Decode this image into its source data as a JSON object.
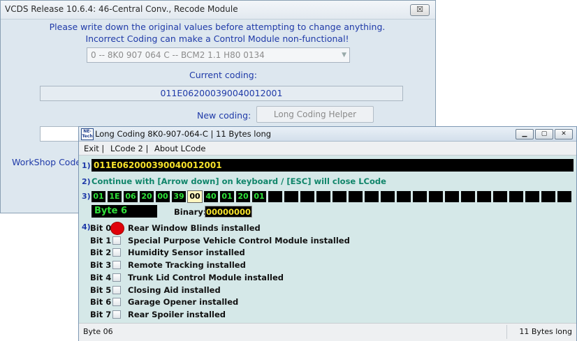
{
  "recode_window": {
    "title": "VCDS Release 10.6.4: 46-Central Conv.,  Recode Module",
    "close_label": "☒",
    "warning_line1": "Please write down the original values before attempting to change anything.",
    "warning_line2": "Incorrect Coding can make a Control Module non-functional!",
    "module_select_value": "0 -- 8K0 907 064 C -- BCM2 1.1      H80 0134",
    "current_coding_label": "Current coding:",
    "current_coding_value": "011E062000390040012001",
    "new_coding_label": "New coding:",
    "long_coding_helper_label": "Long Coding Helper",
    "workshop_code_label": "WorkShop Code"
  },
  "lcode_window": {
    "title": "Long Coding  8K0-907-064-C | 11 Bytes long",
    "logo_text": "NE-Tech",
    "menu": [
      "Exit |",
      "LCode 2 |",
      "About LCode"
    ],
    "step_labels": [
      "1)",
      "2)",
      "3)",
      "4)"
    ],
    "coding_string": "011E062000390040012001",
    "instruction": "Continue with [Arrow down] on keyboard / [ESC] will close LCode",
    "bytes": [
      "01",
      "1E",
      "06",
      "20",
      "00",
      "39",
      "00",
      "40",
      "01",
      "20",
      "01"
    ],
    "selected_byte_index": 6,
    "empty_byte_slots": 19,
    "byte_label": "Byte 6",
    "binary_label": "Binary:",
    "binary_value": "00000000",
    "bits": [
      {
        "name": "Bit 0",
        "label": "Rear Window Blinds installed",
        "active": true
      },
      {
        "name": "Bit 1",
        "label": "Special Purpose Vehicle Control Module installed",
        "active": false
      },
      {
        "name": "Bit 2",
        "label": "Humidity Sensor installed",
        "active": false
      },
      {
        "name": "Bit 3",
        "label": "Remote Tracking installed",
        "active": false
      },
      {
        "name": "Bit 4",
        "label": "Trunk Lid Control Module installed",
        "active": false
      },
      {
        "name": "Bit 5",
        "label": "Closing Aid installed",
        "active": false
      },
      {
        "name": "Bit 6",
        "label": "Garage Opener installed",
        "active": false
      },
      {
        "name": "Bit 7",
        "label": "Rear Spoiler installed",
        "active": false
      }
    ],
    "status_left": "Byte 06",
    "status_right": "11 Bytes long"
  },
  "colors": {
    "label_blue": "#1f3aa8",
    "coding_yellow": "#f5e12a",
    "byte_green": "#2fe23a",
    "active_bit_red": "#e0000a",
    "lcode_bg": "#d5e8e8"
  }
}
